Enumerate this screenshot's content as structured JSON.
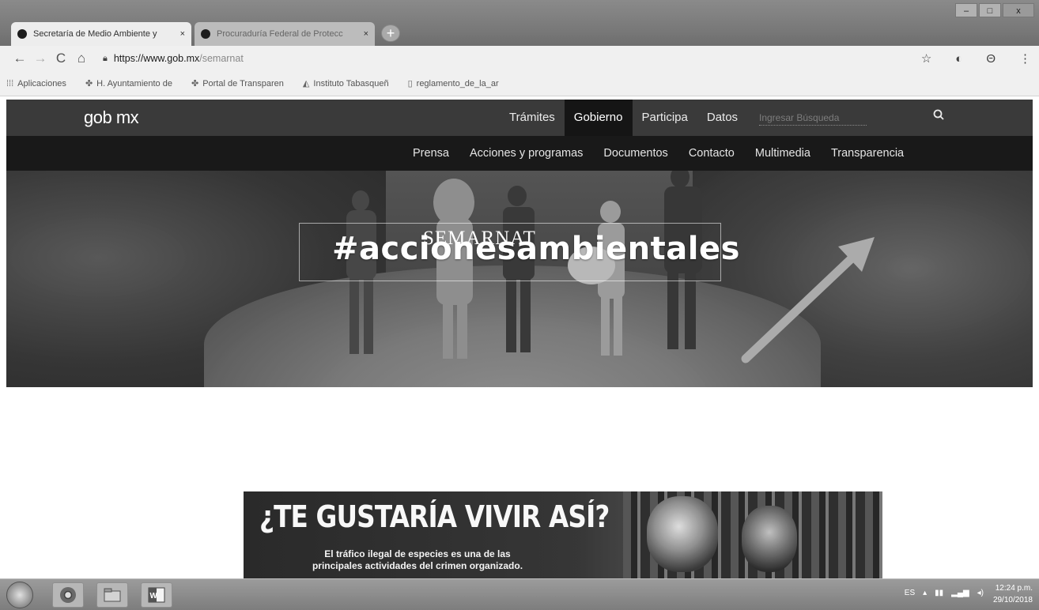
{
  "tabs": [
    {
      "title": "Secretaría de Medio Ambiente y",
      "close": "×",
      "active": true
    },
    {
      "title": "Procuraduría Federal de Protecc",
      "close": "×",
      "active": false
    }
  ],
  "new_tab_label": "+",
  "window_controls": {
    "minimize": "–",
    "maximize": "□",
    "close": "x"
  },
  "toolbar": {
    "back": "←",
    "forward": "→",
    "reload": "C",
    "home": "⌂",
    "url_host": "https://www.gob.mx",
    "url_path": "/semarnat",
    "star": "☆",
    "extension": "◐",
    "account": "Θ",
    "menu": "⋮"
  },
  "bookmarks": [
    {
      "label": "Aplicaciones",
      "icon": "apps-grid-icon"
    },
    {
      "label": "H. Ayuntamiento de",
      "icon": "eagle-icon"
    },
    {
      "label": "Portal de Transparen",
      "icon": "eagle-icon"
    },
    {
      "label": "Instituto Tabasqueñ",
      "icon": "bird-icon"
    },
    {
      "label": "reglamento_de_la_ar",
      "icon": "document-icon"
    }
  ],
  "site": {
    "logo": "gob mx",
    "top_nav": [
      "Trámites",
      "Gobierno",
      "Participa",
      "Datos"
    ],
    "active_top_nav": "Gobierno",
    "search_placeholder": "Ingresar Búsqueda",
    "sub_nav": [
      "Prensa",
      "Acciones y programas",
      "Documentos",
      "Contacto",
      "Multimedia",
      "Transparencia"
    ]
  },
  "hero": {
    "logo_text": "SEMARNAT",
    "hashtag": "#accionesambientales"
  },
  "banner": {
    "title": "¿TE GUSTARÍA VIVIR ASÍ?",
    "subtitle_line1": "El tráfico ilegal de especies es una de las",
    "subtitle_line2": "principales actividades del crimen organizado."
  },
  "taskbar": {
    "apps": [
      "chrome-icon",
      "file-explorer-icon",
      "word-icon"
    ],
    "tray_lang": "ES",
    "time": "12:24 p.m.",
    "date": "29/10/2018"
  },
  "colors": {
    "header_bg": "#3d3d3d",
    "subnav_bg": "#1e1e1e",
    "active_tab": "#1a1a1a"
  }
}
